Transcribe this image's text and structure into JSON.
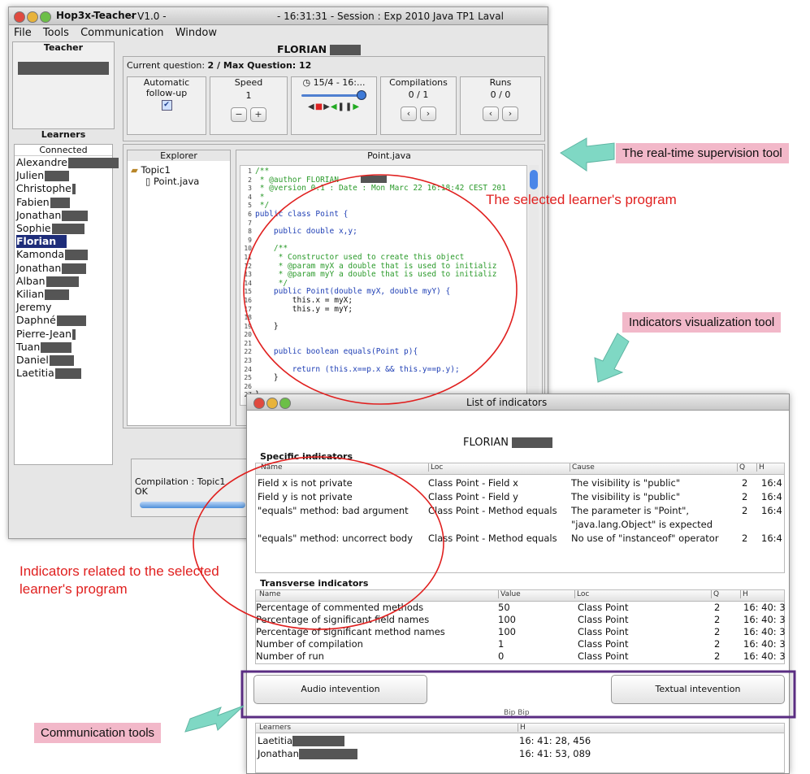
{
  "main_window": {
    "app_name": "Hop3x-Teacher",
    "version": "- V1.0 -",
    "session": "- 16:31:31 - Session : Exp 2010 Java TP1 Laval",
    "menu": [
      "File",
      "Tools",
      "Communication",
      "Window"
    ],
    "teacher_title": "Teacher",
    "learner_name": "FLORIAN",
    "learners_title": "Learners",
    "connected_label": "Connected",
    "learners": [
      "Alexandre",
      "Julien",
      "Christophe",
      "Fabien",
      "Jonathan",
      "Sophie",
      "Florian",
      "Kamonda",
      "Jonathan",
      "Alban",
      "Kilian",
      "Jeremy",
      "Daphné",
      "Pierre-Jean",
      "Tuan",
      "Daniel",
      "Laetitia"
    ],
    "selected_learner": "Florian",
    "question_label": "Current question:",
    "question_value": "2 / Max Question: 12",
    "auto_follow": "Automatic follow-up",
    "speed_label": "Speed",
    "speed_value": "1",
    "date_label": "15/4 - 16:...",
    "compilations_label": "Compilations",
    "compilations_value": "0 / 1",
    "runs_label": "Runs",
    "runs_value": "0 / 0",
    "explorer_title": "Explorer",
    "explorer_items": [
      "Topic1",
      "Point.java"
    ],
    "file_title": "Point.java",
    "code_lines": [
      "/**",
      " * @author FLORIAN",
      " * @version 0.1 : Date : Mon Marc 22 16:18:42 CEST 201",
      " *",
      " */",
      "public class Point {",
      "",
      "    public double x,y;",
      "",
      "    /**",
      "     * Constructor used to create this object",
      "     * @param myX a double that is used to initializ",
      "     * @param myY a double that is used to initializ",
      "     */",
      "    public Point(double myX, double myY) {",
      "        this.x = myX;",
      "        this.y = myY;",
      "",
      "    }",
      "",
      "",
      "    public boolean equals(Point p){",
      "",
      "        return (this.x==p.x && this.y==p.y);",
      "    }",
      "",
      "}"
    ],
    "compile_line1": "Compilation : Topic1",
    "compile_line2": "OK"
  },
  "indicators_window": {
    "title": "List of indicators",
    "learner_name": "FLORIAN",
    "specific_title": "Specific indicators",
    "specific_headers": [
      "Name",
      "Loc",
      "Cause",
      "Q",
      "H"
    ],
    "specific_rows": [
      {
        "name": "Field x is not private",
        "loc": "Class Point - Field x",
        "cause": "The visibility is \"public\"",
        "cause2": "",
        "q": "2",
        "h": "16:4"
      },
      {
        "name": "Field y is not private",
        "loc": "Class Point - Field y",
        "cause": "The visibility is \"public\"",
        "cause2": "",
        "q": "2",
        "h": "16:4"
      },
      {
        "name": "\"equals\" method: bad argument",
        "loc": "Class Point - Method equals",
        "cause": "The parameter is \"Point\",",
        "cause2": "\"java.lang.Object\" is expected",
        "q": "2",
        "h": "16:4"
      },
      {
        "name": "\"equals\" method: uncorrect body",
        "loc": "Class Point - Method equals",
        "cause": "No use of \"instanceof\" operator",
        "cause2": "",
        "q": "2",
        "h": "16:4"
      }
    ],
    "transverse_title": "Transverse indicators",
    "transverse_headers": [
      "Name",
      "Value",
      "Loc",
      "Q",
      "H"
    ],
    "transverse_rows": [
      {
        "name": "Percentage of commented methods",
        "value": "50",
        "loc": "Class Point",
        "q": "2",
        "h": "16: 40: 3"
      },
      {
        "name": "Percentage of significant field names",
        "value": "100",
        "loc": "Class Point",
        "q": "2",
        "h": "16: 40: 3"
      },
      {
        "name": "Percentage of significant method names",
        "value": "100",
        "loc": "Class Point",
        "q": "2",
        "h": "16: 40: 3"
      },
      {
        "name": "Number of compilation",
        "value": "1",
        "loc": "Class Point",
        "q": "2",
        "h": "16: 40: 3"
      },
      {
        "name": "Number of run",
        "value": "0",
        "loc": "Class Point",
        "q": "2",
        "h": "16: 40: 3"
      }
    ],
    "audio_button": "Audio intevention",
    "text_button": "Textual intevention",
    "bip_label": "Bip Bip",
    "learners_headers": [
      "Learners",
      "H"
    ],
    "learners_rows": [
      {
        "name": "Laetitia",
        "h": "16: 41: 28, 456"
      },
      {
        "name": "Jonathan",
        "h": "16: 41: 53, 089"
      }
    ]
  },
  "annotations": {
    "supervision_tool": "The real-time supervision tool",
    "selected_program": "The selected learner's program",
    "indicators_tool": "Indicators visualization tool",
    "indicators_related_1": "Indicators related to the selected",
    "indicators_related_2": "learner's program",
    "communication_tools": "Communication tools"
  },
  "colors": {
    "accent_pink": "#f2b8c9",
    "annotation_red": "#e0201f",
    "arrow_teal": "#7fd8c4",
    "frame_purple": "#5a2d82",
    "selected_bg": "#1e2d7a"
  }
}
